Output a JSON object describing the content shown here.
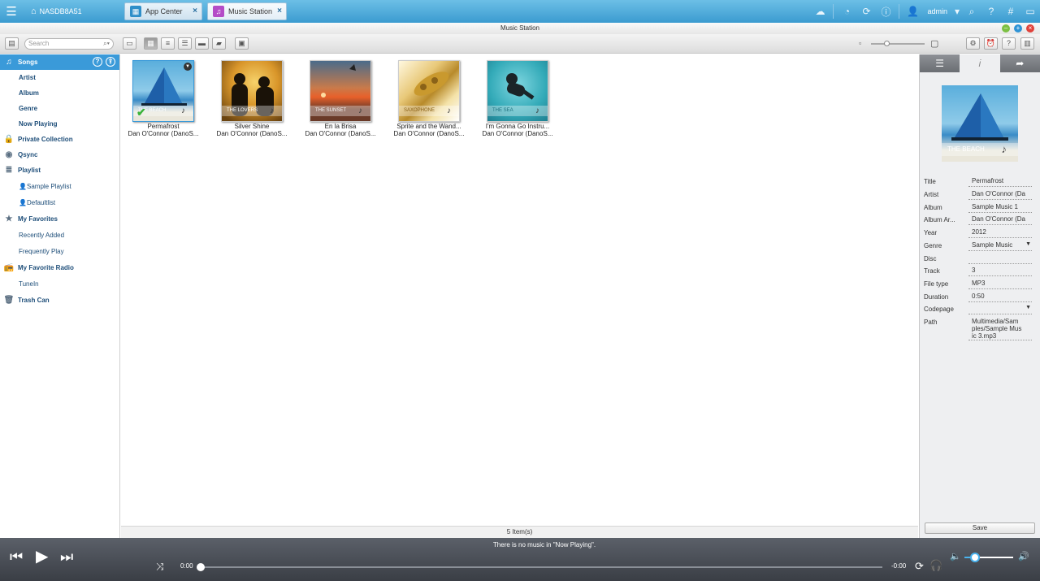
{
  "topbar": {
    "nas_name": "NASDB8A51",
    "tabs": [
      {
        "label": "App Center"
      },
      {
        "label": "Music Station"
      }
    ],
    "username": "admin"
  },
  "window": {
    "title": "Music Station"
  },
  "toolbar": {
    "search_placeholder": "Search"
  },
  "sidebar": {
    "items": [
      {
        "label": "Songs"
      },
      {
        "label": "Artist"
      },
      {
        "label": "Album"
      },
      {
        "label": "Genre"
      },
      {
        "label": "Now Playing"
      },
      {
        "label": "Private Collection"
      },
      {
        "label": "Qsync"
      },
      {
        "label": "Playlist"
      },
      {
        "label": "Sample Playlist"
      },
      {
        "label": "Defaultlist"
      },
      {
        "label": "My Favorites"
      },
      {
        "label": "Recently Added"
      },
      {
        "label": "Frequently Play"
      },
      {
        "label": "My Favorite Radio"
      },
      {
        "label": "TuneIn"
      },
      {
        "label": "Trash Can"
      }
    ]
  },
  "albums": [
    {
      "title": "Permafrost",
      "artist": "Dan O'Connor (DanoS...",
      "cover_text": "THE BEACH"
    },
    {
      "title": "Silver Shine",
      "artist": "Dan O'Connor (DanoS...",
      "cover_text": "THE LOVERS"
    },
    {
      "title": "En la Brisa",
      "artist": "Dan O'Connor (DanoS...",
      "cover_text": "THE SUNSET"
    },
    {
      "title": "Sprite and the Wand...",
      "artist": "Dan O'Connor (DanoS...",
      "cover_text": "SAXOPHONE"
    },
    {
      "title": "I'm Gonna Go Instru...",
      "artist": "Dan O'Connor (DanoS...",
      "cover_text": "THE SEA"
    }
  ],
  "status": {
    "count": "5 Item(s)"
  },
  "details": {
    "cover_text": "THE BEACH",
    "fields": [
      {
        "label": "Title",
        "value": "Permafrost"
      },
      {
        "label": "Artist",
        "value": "Dan O'Connor (Da"
      },
      {
        "label": "Album",
        "value": "Sample Music 1"
      },
      {
        "label": "Album Ar...",
        "value": "Dan O'Connor (Da"
      },
      {
        "label": "Year",
        "value": "2012"
      },
      {
        "label": "Genre",
        "value": "Sample Music"
      },
      {
        "label": "Disc",
        "value": ""
      },
      {
        "label": "Track",
        "value": "3"
      },
      {
        "label": "File type",
        "value": "MP3"
      },
      {
        "label": "Duration",
        "value": "0:50"
      },
      {
        "label": "Codepage",
        "value": ""
      }
    ],
    "path_label": "Path",
    "path_lines": [
      "Multimedia/Sam",
      "ples/Sample Mus",
      "ic 3.mp3"
    ],
    "save_label": "Save"
  },
  "player": {
    "message": "There is no music in \"Now Playing\".",
    "time_elapsed": "0:00",
    "time_remaining": "-0:00"
  }
}
